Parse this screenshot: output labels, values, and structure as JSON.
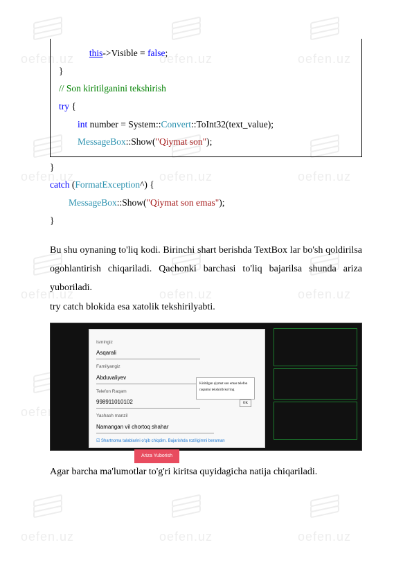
{
  "code": {
    "line1a": "this",
    "line1b": "->Visible = ",
    "line1c": "false",
    "line1d": ";",
    "line2": "}",
    "line3": "// Son kiritilganini tekshirish",
    "line4a": "try",
    "line4b": " {",
    "line5a": "int",
    "line5b": " number = System::",
    "line5c": "Convert",
    "line5d": "::ToInt32(text_value);",
    "line6a": "MessageBox",
    "line6b": "::Show(",
    "line6c": "\"Qiymat son\"",
    "line6d": ");",
    "line7": "}",
    "line8a": "catch",
    "line8b": " (",
    "line8c": "FormatException",
    "line8d": "^) {",
    "line9a": "MessageBox",
    "line9b": "::Show(",
    "line9c": "\"Qiymat son emas\"",
    "line9d": ");",
    "line10": "}"
  },
  "paragraph1": "Bu shu oynaning to'liq kodi. Birinchi shart berishda TextBox lar bo'sh qoldirilsa ogohlantirish chiqariladi. Qachonki barchasi to'liq bajarilsa shunda ariza yuboriladi.",
  "paragraph2": "try catch blokida esa xatolik tekshirilyabti.",
  "screenshot": {
    "label_ism": "Ismingiz",
    "val_ism": "Asqarali",
    "label_fam": "Familyangiz",
    "val_fam": "Abduvaliyev",
    "label_tel": "Telefon Raqam",
    "val_tel": "998911010102",
    "label_man": "Yashash manzil",
    "val_man": "Namangan vil chortoq shahar",
    "checkbox": "☑ Shartnoma talablarini o'qib chiqdim. Bajarishda roziligimni beraman",
    "button": "Ariza Yuborish",
    "msgbox_text": "Kiritilgan qiymat son emas telefon raqamni tekshirib ko'ring",
    "msgbox_ok": "OK"
  },
  "paragraph3": "Agar barcha ma'lumotlar to'g'ri kiritsa quyidagicha natija chiqariladi."
}
